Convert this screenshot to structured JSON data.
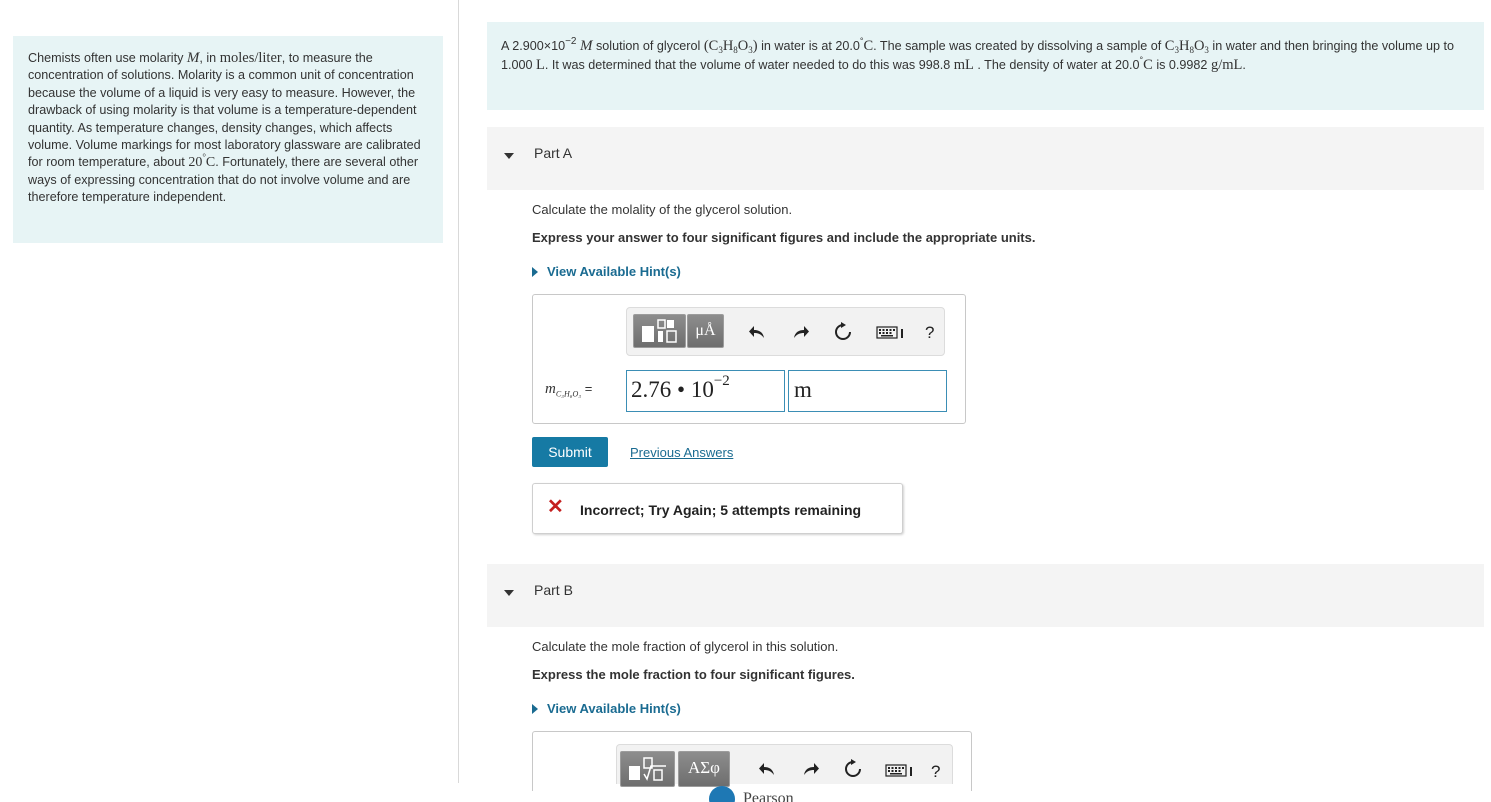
{
  "intro": {
    "text_1": "Chemists often use molarity",
    "molarity_symbol": "M",
    "text_2": ", in",
    "units": "moles/liter",
    "text_3": ", to measure the concentration of solutions. Molarity is a common unit of concentration because the volume of a liquid is very easy to measure. However, the drawback of using molarity is that volume is a temperature-dependent quantity. As temperature changes, density changes, which affects volume. Volume markings for most laboratory glassware are calibrated for room temperature, about",
    "room_temp_value": "20",
    "degree": "°",
    "room_temp_unit": "C",
    "text_4": ". Fortunately, there are several other ways of expressing concentration that do not involve volume and are therefore temperature independent."
  },
  "problem": {
    "text_1": "A 2.900×10",
    "exponent": "−2",
    "molarity_symbol": "M",
    "text_2": "solution of glycerol",
    "formula_open": "(C",
    "c_sub": "3",
    "h": "H",
    "h_sub": "8",
    "o": "O",
    "o_sub": "3",
    "formula_close": ")",
    "text_3": "in water is at 20.0",
    "degree": "°",
    "c_unit": "C",
    "text_4": ". The sample was created by dissolving a sample of",
    "text_5": "in water and then bringing the volume up to 1.000",
    "liter": "L",
    "text_6": ". It was determined that the volume of water needed to do this was 998.8",
    "ml": "mL",
    "text_7": ". The density of water at 20.0",
    "text_8": "is 0.9982",
    "density_unit": "g/mL",
    "text_9": "."
  },
  "part_a": {
    "title": "Part A",
    "question": "Calculate the molality of the glycerol solution.",
    "instruction": "Express your answer to four significant figures and include the appropriate units.",
    "hint_label": "View Available Hint(s)",
    "toolbar_unit_label": "μÅ",
    "help_label": "?",
    "eq_var": "m",
    "eq_sub": "C₃H₈O₃",
    "eq_equals": "=",
    "answer_mantissa": "2.76",
    "answer_times": "•",
    "answer_base": "10",
    "answer_exp": "−2",
    "answer_unit": "m",
    "submit_label": "Submit",
    "previous_answers_label": "Previous Answers",
    "feedback_icon": "✕",
    "feedback_text": "Incorrect; Try Again; 5 attempts remaining"
  },
  "part_b": {
    "title": "Part B",
    "question": "Calculate the mole fraction of glycerol in this solution.",
    "instruction": "Express the mole fraction to four significant figures.",
    "hint_label": "View Available Hint(s)",
    "toolbar_symbols_label": "ΑΣφ",
    "help_label": "?"
  },
  "footer": {
    "brand": "Pearson"
  },
  "colors": {
    "info_bg": "#e7f4f5",
    "link": "#1a6b91",
    "submit_bg": "#167aa4",
    "error": "#c41f1f",
    "input_border": "#3b8eb5"
  }
}
